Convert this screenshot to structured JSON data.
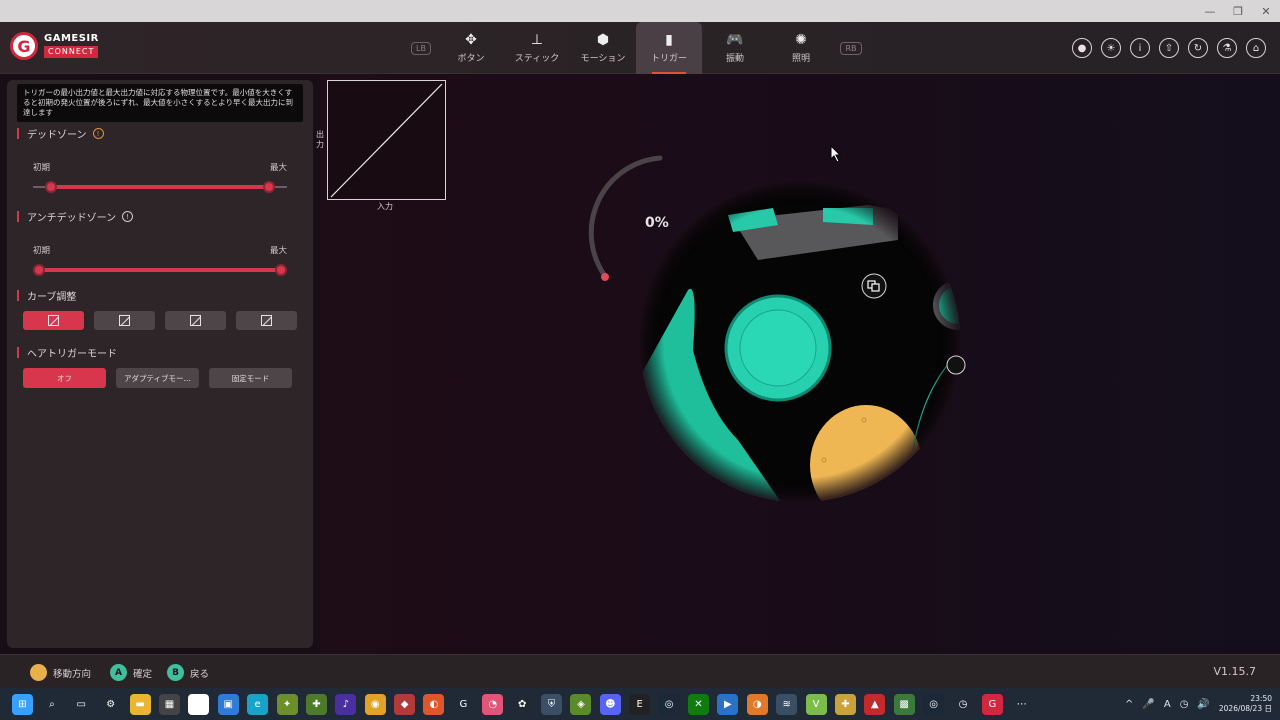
{
  "window": {
    "controls": [
      "—",
      "❐",
      "✕"
    ]
  },
  "logo": {
    "line1": "GAMESIR",
    "line2": "CONNECT",
    "mark": "G"
  },
  "nav": {
    "lb": "LB",
    "rb": "RB",
    "tabs": [
      {
        "label": "ボタン",
        "icon": "buttons-icon",
        "glyph": "✥"
      },
      {
        "label": "スティック",
        "icon": "stick-icon",
        "glyph": "⊥"
      },
      {
        "label": "モーション",
        "icon": "motion-cube-icon",
        "glyph": "⬢"
      },
      {
        "label": "トリガー",
        "icon": "trigger-icon",
        "glyph": "▮",
        "active": true
      },
      {
        "label": "振動",
        "icon": "gamepad-icon",
        "glyph": "🎮"
      },
      {
        "label": "照明",
        "icon": "lightbulb-icon",
        "glyph": "✺"
      }
    ],
    "active_color": "#e0532f"
  },
  "right_icons": [
    {
      "icon": "record-icon",
      "glyph": "●"
    },
    {
      "icon": "brightness-icon",
      "glyph": "☀"
    },
    {
      "icon": "info-icon",
      "glyph": "i"
    },
    {
      "icon": "upload-icon",
      "glyph": "⇧"
    },
    {
      "icon": "reset-icon",
      "glyph": "↻"
    },
    {
      "icon": "flask-icon",
      "glyph": "⚗"
    },
    {
      "icon": "home-icon",
      "glyph": "⌂"
    }
  ],
  "panel": {
    "tooltip": "トリガーの最小出力値と最大出力値に対応する物理位置です。最小値を大きくすると初期の発火位置が後ろにずれ、最大値を小さくするとより早く最大出力に到達します",
    "deadzone": {
      "title": "デッドゾーン",
      "min_label": "初期",
      "max_label": "最大",
      "min_value": 0.05,
      "max_value": 0.95
    },
    "anti_deadzone": {
      "title": "アンチデッドゾーン",
      "min_label": "初期",
      "max_label": "最大",
      "min_value": 0.0,
      "max_value": 1.0
    },
    "curve": {
      "title": "カーブ調整",
      "buttons": [
        {
          "icon": "linear-curve-icon",
          "active": true
        },
        {
          "icon": "concave-curve-icon",
          "active": false
        },
        {
          "icon": "convex-curve-icon",
          "active": false
        },
        {
          "icon": "custom-curve-icon",
          "active": false
        }
      ]
    },
    "hair_trigger": {
      "title": "ヘアトリガーモード",
      "options": [
        {
          "label": "オフ",
          "active": true
        },
        {
          "label": "アダプティブモー…",
          "active": false
        },
        {
          "label": "固定モード",
          "active": false
        }
      ]
    },
    "accent_color": "#d7364c"
  },
  "graph": {
    "ylabel": "出力",
    "xlabel": "入力"
  },
  "trigger_view": {
    "progress_text": "0%",
    "progress": 0.0
  },
  "bottom": {
    "hints": [
      {
        "label": "移動方向",
        "icon": "dpad-icon",
        "glyph": "",
        "color": "#e8b04a"
      },
      {
        "label": "確定",
        "icon": "a-button-icon",
        "glyph": "A",
        "color": "#3fbfa0"
      },
      {
        "label": "戻る",
        "icon": "b-button-icon",
        "glyph": "B",
        "color": "#3fbfa0"
      }
    ],
    "version": "V1.15.7"
  },
  "taskbar": {
    "icons": [
      {
        "name": "windows-start-icon",
        "glyph": "⊞",
        "color": "#3aa0ff"
      },
      {
        "name": "search-icon",
        "glyph": "⌕",
        "color": "#1f2a36"
      },
      {
        "name": "task-view-icon",
        "glyph": "▭",
        "color": "#1f2a36"
      },
      {
        "name": "settings-icon",
        "glyph": "⚙",
        "color": "#1f2a36"
      },
      {
        "name": "file-explorer-icon",
        "glyph": "▬",
        "color": "#e9b533"
      },
      {
        "name": "calculator-icon",
        "glyph": "▦",
        "color": "#444"
      },
      {
        "name": "notepad-icon",
        "glyph": "✎",
        "color": "#fff"
      },
      {
        "name": "store-icon",
        "glyph": "▣",
        "color": "#2f7bd8"
      },
      {
        "name": "edge-icon",
        "glyph": "e",
        "color": "#1aa3c9"
      },
      {
        "name": "app-icon-1",
        "glyph": "✦",
        "color": "#6c8f2a"
      },
      {
        "name": "app-icon-2",
        "glyph": "✚",
        "color": "#4e7a2c"
      },
      {
        "name": "amazon-music-icon",
        "glyph": "♪",
        "color": "#4a2fa0"
      },
      {
        "name": "chrome-icon",
        "glyph": "◉",
        "color": "#e0a329"
      },
      {
        "name": "app-icon-3",
        "glyph": "◆",
        "color": "#b33a3a"
      },
      {
        "name": "firefox-icon",
        "glyph": "◐",
        "color": "#e0562a"
      },
      {
        "name": "app-icon-4",
        "glyph": "G",
        "color": "#1f2a36"
      },
      {
        "name": "app-icon-5",
        "glyph": "◔",
        "color": "#e05578"
      },
      {
        "name": "app-icon-6",
        "glyph": "✿",
        "color": "#1f2a36"
      },
      {
        "name": "shield-icon",
        "glyph": "⛨",
        "color": "#3a4e66"
      },
      {
        "name": "app-icon-7",
        "glyph": "◈",
        "color": "#5a8a2a"
      },
      {
        "name": "discord-icon",
        "glyph": "☻",
        "color": "#5865f2"
      },
      {
        "name": "epic-games-icon",
        "glyph": "E",
        "color": "#222"
      },
      {
        "name": "steam-icon",
        "glyph": "◎",
        "color": "#1b2838"
      },
      {
        "name": "xbox-icon",
        "glyph": "✕",
        "color": "#107c10"
      },
      {
        "name": "app-icon-8",
        "glyph": "▶",
        "color": "#2a72c6"
      },
      {
        "name": "app-icon-9",
        "glyph": "◑",
        "color": "#e07a2a"
      },
      {
        "name": "app-icon-10",
        "glyph": "≋",
        "color": "#3a4e66"
      },
      {
        "name": "app-icon-11",
        "glyph": "V",
        "color": "#7dbb4a"
      },
      {
        "name": "app-icon-12",
        "glyph": "✚",
        "color": "#c9a23a"
      },
      {
        "name": "app-icon-13",
        "glyph": "▲",
        "color": "#c42a2a"
      },
      {
        "name": "app-icon-14",
        "glyph": "▩",
        "color": "#3b7a3a"
      },
      {
        "name": "steam-icon-2",
        "glyph": "◎",
        "color": "#1b2838"
      },
      {
        "name": "app-icon-15",
        "glyph": "◷",
        "color": "#1f2a36"
      },
      {
        "name": "gamesir-connect-icon",
        "glyph": "G",
        "color": "#d0283e"
      },
      {
        "name": "more-icon",
        "glyph": "⋯",
        "color": "#1f2a36"
      }
    ],
    "tray": [
      "^",
      "🎤",
      "A",
      "◷",
      "🔊"
    ],
    "time": "23:50",
    "date": "2026/08/23 日"
  }
}
